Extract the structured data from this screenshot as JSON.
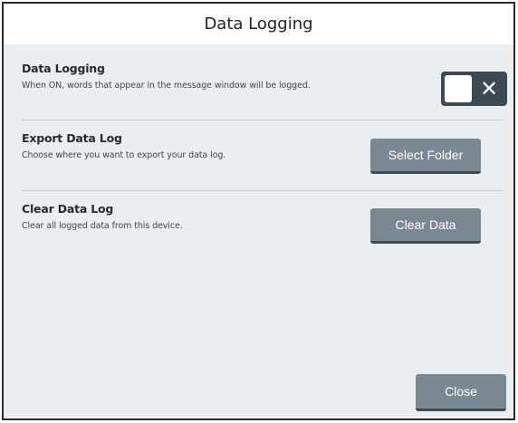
{
  "dialog": {
    "title": "Data Logging"
  },
  "data_logging": {
    "title": "Data Logging",
    "description": "When ON, words that appear in the message window will be logged.",
    "toggle": {
      "state": "off",
      "off_glyph": "✕"
    }
  },
  "export_data_log": {
    "title": "Export Data Log",
    "description": "Choose where you want to export your data log.",
    "button_label": "Select Folder"
  },
  "clear_data_log": {
    "title": "Clear Data Log",
    "description": "Clear all logged data from this device.",
    "button_label": "Clear Data"
  },
  "footer": {
    "close_label": "Close"
  },
  "colors": {
    "button": "#7a8894",
    "toggle": "#3e4a53",
    "background": "#ebeef1"
  }
}
